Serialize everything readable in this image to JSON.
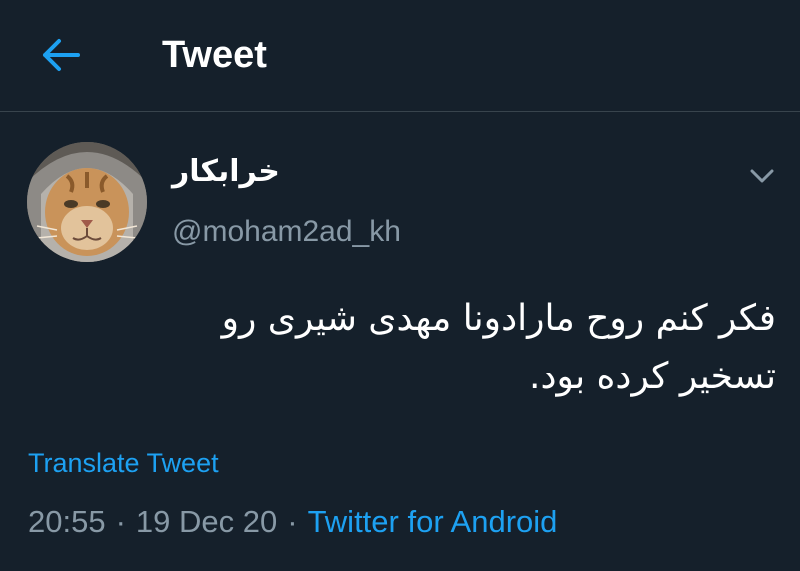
{
  "header": {
    "title": "Tweet",
    "back_icon": "arrow-left-icon"
  },
  "tweet": {
    "display_name": "خرابکار",
    "handle": "@moham2ad_kh",
    "text": "فکر کنم روح مارادونا مهدی شیری رو\nتسخیر کرده بود.",
    "translate_label": "Translate Tweet",
    "time": "20:55",
    "date": "19 Dec 20",
    "separator": "·",
    "source": "Twitter for Android",
    "menu_icon": "chevron-down-icon",
    "avatar": "cat-avatar"
  },
  "colors": {
    "background": "#15202b",
    "accent": "#1da1f2",
    "secondary_text": "#8899a6",
    "divider": "#38444d"
  }
}
